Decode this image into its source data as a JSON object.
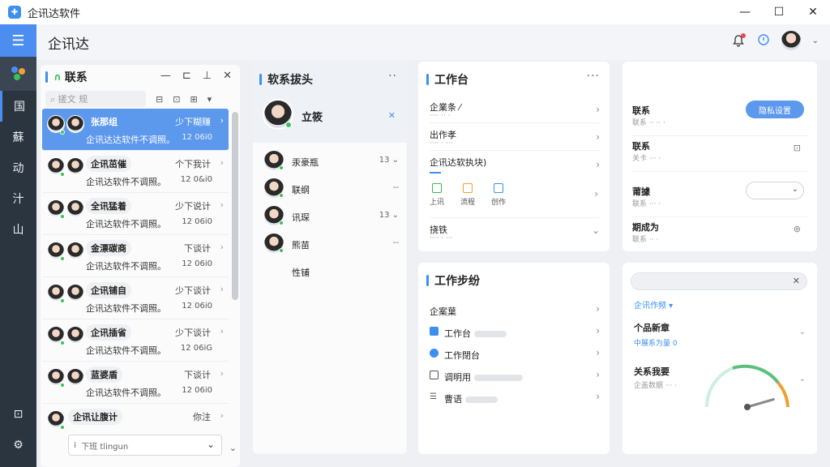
{
  "app": {
    "title": "企讯达软件",
    "header_title": "企讯达",
    "logo_glyph": "✚"
  },
  "window": {
    "minimize": "—",
    "maximize": "☐",
    "close": "✕"
  },
  "rail": {
    "items": [
      "​",
      "国",
      "蘇",
      "动",
      "汁",
      "山"
    ],
    "bottom": [
      "⊡",
      "⚙"
    ]
  },
  "contacts": {
    "title": "联系",
    "tools": [
      "—",
      "⊏",
      "⊥",
      "✕"
    ],
    "search_placeholder": "⌕ 搓文 规",
    "search_tools": [
      "⊟",
      "⊡",
      "⊞",
      "▾"
    ],
    "items": [
      {
        "name": "张那组",
        "status": "少下糊赚",
        "preview": "企讯达达软件不调照。",
        "time": "12 06i0",
        "selected": true
      },
      {
        "name": "企讯茁催",
        "status": "个下我计",
        "preview": "企讯达软件不调照。",
        "time": "12 0&i0",
        "selected": false
      },
      {
        "name": "全讯猛着",
        "status": "少下说计",
        "preview": "企讯达软件不调照。",
        "time": "12 06i0",
        "selected": false
      },
      {
        "name": "金漂碳商",
        "status": "下谈计",
        "preview": "企讯达软件不调照。",
        "time": "12 06i0",
        "selected": false
      },
      {
        "name": "企讯铺自",
        "status": "少下谈计",
        "preview": "企讯达软件不调照。",
        "time": "12 06i0",
        "selected": false
      },
      {
        "name": "企讯插省",
        "status": "少下谈计",
        "preview": "企讯达软件不调照。",
        "time": "12 06iG",
        "selected": false
      },
      {
        "name": "蓝婆盾",
        "status": "下谈计",
        "preview": "企讯达软件不调照。",
        "time": "12 06i0",
        "selected": false
      },
      {
        "name": "企讯让腹计",
        "status": "你注",
        "preview": "",
        "time": "",
        "selected": false
      }
    ],
    "reply_placeholder": "下班 tlingun",
    "scroll_down": "⌄"
  },
  "profile": {
    "title": "软系拔头",
    "name": "立筱",
    "close_glyph": "✕",
    "members": [
      {
        "name": "汞豪瓶",
        "right": "13 ⌄"
      },
      {
        "name": "联纲",
        "right": "--"
      },
      {
        "name": "讯琛",
        "right": "13 ⌄"
      },
      {
        "name": "熊苗",
        "right": "--"
      },
      {
        "name": "性铺",
        "right": ""
      }
    ]
  },
  "workbench": {
    "title": "工作台",
    "more": "···",
    "rows": [
      {
        "title": "企業条 ⁄",
        "sub": "···· ·· ·"
      },
      {
        "title": "出作孝",
        "sub": "···· · ···"
      },
      {
        "title": "企讯达软执块)",
        "sub": ""
      },
      {
        "title": "挠铁",
        "sub": "···· · ···"
      }
    ],
    "quick": [
      {
        "label": "上讯",
        "color": "#39b55a"
      },
      {
        "label": "流程",
        "color": "#f0a030"
      },
      {
        "label": "创作",
        "color": "#3d8ff0"
      }
    ]
  },
  "workflow": {
    "title": "工作步纷",
    "rows": [
      {
        "title": "企案葉",
        "icon": "",
        "icon_color": ""
      },
      {
        "title": "工作台",
        "icon": "square",
        "icon_color": "#3d8ff0"
      },
      {
        "title": "工作閉台",
        "icon": "circle",
        "icon_color": "#3d8ff0"
      },
      {
        "title": "调明用",
        "icon": "folder",
        "icon_color": "#555"
      },
      {
        "title": "曹语",
        "icon": "list",
        "icon_color": "#555"
      }
    ]
  },
  "settings": {
    "rows": [
      {
        "title": "联系",
        "sub": "联系 ·· ·· ·",
        "control": "button",
        "button_label": "隐私设置"
      },
      {
        "title": "联系",
        "sub": "关卡 ··· ·",
        "control": "icon",
        "icon": "⊡"
      },
      {
        "title": "莆據",
        "sub": "联系 ··· ·",
        "control": "select"
      },
      {
        "title": "期成为",
        "sub": "联系 ·· ·",
        "control": "icon",
        "icon": "⊚"
      }
    ]
  },
  "gauge": {
    "clear": "✕",
    "link": "企讯作频 ▾",
    "items": [
      {
        "title": "个品新章",
        "sub": "中展系为量 0"
      },
      {
        "title": "关系我要",
        "sub": "企盖数据 ··· ·"
      }
    ],
    "value_fraction": 0.78,
    "colors": {
      "low": "#cdeee0",
      "mid": "#5cc07a",
      "high": "#f0a030"
    }
  },
  "colors": {
    "accent": "#3d8ff0",
    "rail": "#2b3540",
    "online": "#39c15a",
    "alert": "#e84a4a"
  }
}
